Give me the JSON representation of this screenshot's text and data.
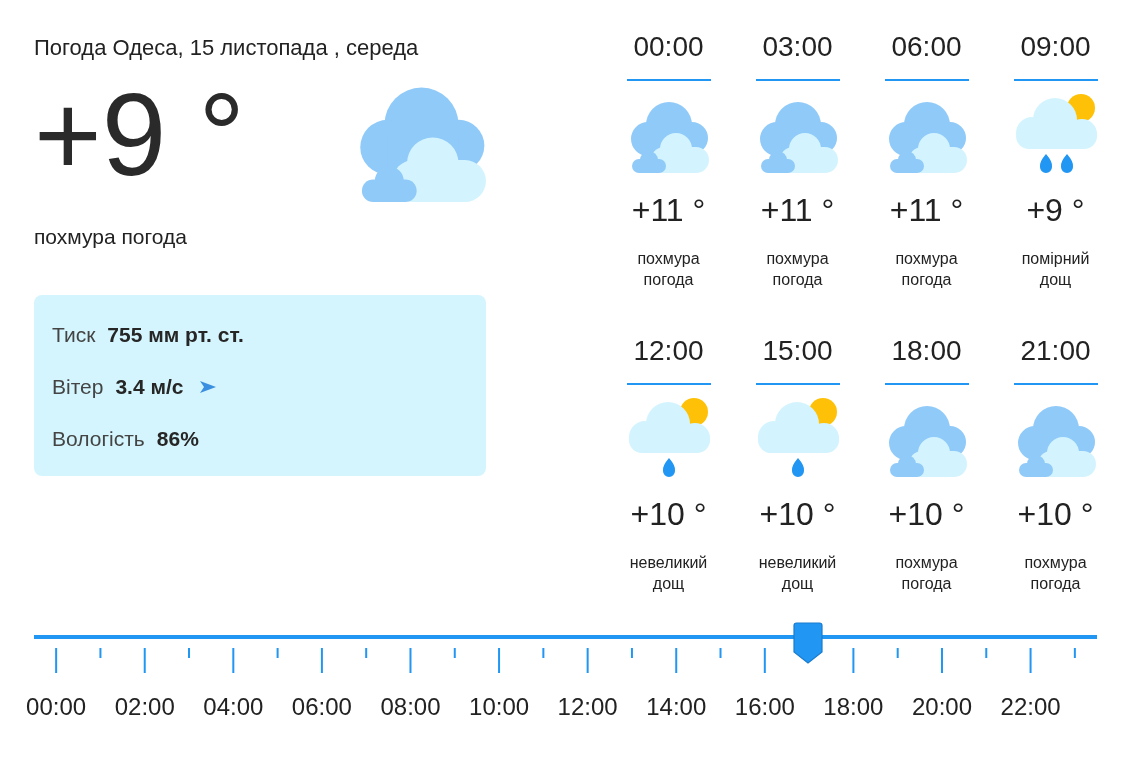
{
  "header": {
    "title": "Погода Одеса, 15 листопада , середа"
  },
  "now": {
    "temperature": "+9 °",
    "kind": "overcast",
    "description": "похмура погода"
  },
  "details": [
    {
      "kind": "pressure",
      "label": "Тиск",
      "value": "755 мм рт. ст."
    },
    {
      "kind": "wind",
      "label": "Вітер",
      "value": "3.4 м/с"
    },
    {
      "kind": "humidity",
      "label": "Вологість",
      "value": "86%"
    }
  ],
  "forecast": [
    {
      "time": "00:00",
      "kind": "overcast",
      "temperature": "+11 °",
      "description": "похмура погода"
    },
    {
      "time": "03:00",
      "kind": "overcast",
      "temperature": "+11 °",
      "description": "похмура погода"
    },
    {
      "time": "06:00",
      "kind": "overcast",
      "temperature": "+11 °",
      "description": "похмура погода"
    },
    {
      "time": "09:00",
      "kind": "moderate-rain",
      "temperature": "+9 °",
      "description": "помірний дощ"
    },
    {
      "time": "12:00",
      "kind": "light-rain",
      "temperature": "+10 °",
      "description": "невеликий дощ"
    },
    {
      "time": "15:00",
      "kind": "light-rain",
      "temperature": "+10 °",
      "description": "невеликий дощ"
    },
    {
      "time": "18:00",
      "kind": "overcast",
      "temperature": "+10 °",
      "description": "похмура погода"
    },
    {
      "time": "21:00",
      "kind": "overcast",
      "temperature": "+10 °",
      "description": "похмура погода"
    }
  ],
  "timeline": {
    "level": 0.728,
    "labels": [
      "00:00",
      "02:00",
      "04:00",
      "06:00",
      "08:00",
      "10:00",
      "12:00",
      "14:00",
      "16:00",
      "18:00",
      "20:00",
      "22:00"
    ]
  }
}
